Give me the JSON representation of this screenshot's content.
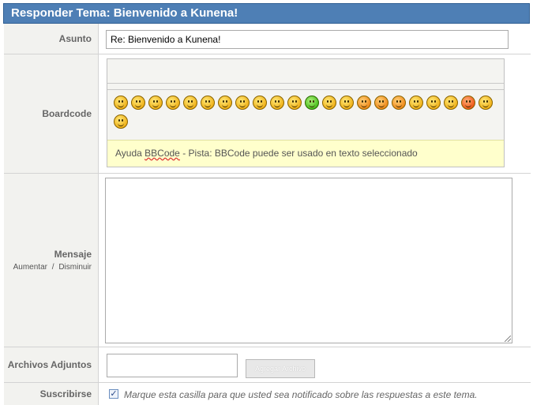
{
  "header": {
    "title": "Responder Tema: Bienvenido a Kunena!"
  },
  "subject": {
    "label": "Asunto",
    "value": "Re: Bienvenido a Kunena!"
  },
  "boardcode": {
    "label": "Boardcode",
    "help_link": "BBCode",
    "help_prefix": "Ayuda ",
    "help_text": " - Pista: BBCode puede ser usado en texto seleccionado",
    "smileys": [
      "cool",
      "sad",
      "smile",
      "happy",
      "wink",
      "tongue",
      "angry",
      "shock",
      "surprised",
      "confused",
      "grin",
      "sick",
      "sleepy",
      "blink",
      "blush",
      "blush",
      "oops",
      "laugh",
      "straight-face",
      "dizzy",
      "devil",
      "love",
      "kiss"
    ]
  },
  "message": {
    "label": "Mensaje",
    "increase": "Aumentar",
    "separator": "/",
    "decrease": "Disminuir",
    "value": ""
  },
  "attachments": {
    "label": "Archivos Adjuntos",
    "button": "Agregar Archivo"
  },
  "subscribe": {
    "label": "Suscribirse",
    "checked": true,
    "checkmark": "✓",
    "text": "Marque esta casilla para que usted sea notificado sobre las respuestas a este tema."
  }
}
